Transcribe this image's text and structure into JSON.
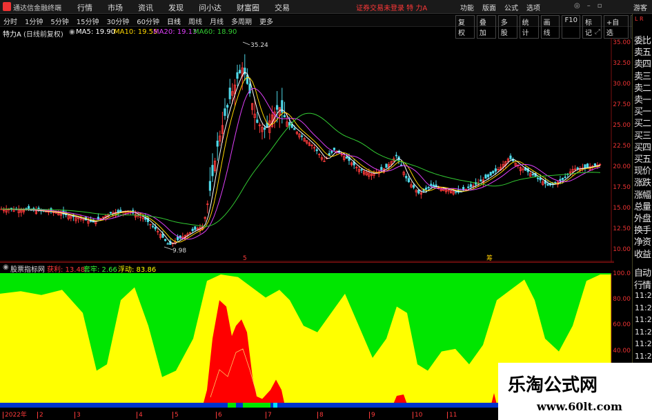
{
  "titlebar": {
    "app_name": "通达信金融终端",
    "menu": [
      "行情",
      "市场",
      "资讯",
      "发现",
      "问小达",
      "财富圈",
      "交易"
    ],
    "alert": "证券交易未登录  特 力A",
    "right_menu": [
      "功能",
      "版面",
      "公式",
      "选项"
    ],
    "guest": "游客"
  },
  "periods": [
    "分时",
    "1分钟",
    "5分钟",
    "15分钟",
    "30分钟",
    "60分钟",
    "日线",
    "周线",
    "月线",
    "多周期",
    "更多"
  ],
  "active_period": "日线",
  "tools": [
    "复权",
    "叠加",
    "多股",
    "统计",
    "画线",
    "F10",
    "标记",
    "+自选",
    "返回"
  ],
  "info": {
    "stock": "特力A",
    "mode": "(日线前复权)",
    "ma5": "MA5: 19.90",
    "ma10": "MA10: 19.55",
    "ma20": "MA20: 19.13",
    "ma60": "MA60: 18.90"
  },
  "indicator": {
    "name": "股票指标网",
    "lbl1": "获利: 13.48",
    "lbl2": "套牢: 2.66",
    "lbl3": "浮动: 83.86"
  },
  "annotations": {
    "high": "35.24",
    "low": "9.98",
    "m1": "5",
    "m2": "筹"
  },
  "y_axis_main": [
    "35.00",
    "32.50",
    "30.00",
    "27.50",
    "25.00",
    "22.50",
    "20.00",
    "17.50",
    "15.00",
    "12.50",
    "10.00"
  ],
  "y_axis_sub": [
    "100.0",
    "80.00",
    "60.00",
    "40.00"
  ],
  "x_axis": [
    "2022年",
    "2",
    "3",
    "4",
    "5",
    "6",
    "7",
    "8",
    "9",
    "10",
    "11"
  ],
  "sidepanel": {
    "corner": "L R",
    "items": [
      "委比",
      "卖五",
      "卖四",
      "卖三",
      "卖二",
      "卖一",
      "买一",
      "买二",
      "买三",
      "买四",
      "买五",
      "现价",
      "涨跌",
      "涨幅",
      "总量",
      "外盘",
      "换手",
      "净资",
      "收益",
      "自动",
      "行情"
    ],
    "times": [
      "11:28",
      "11:28",
      "11:28",
      "11:27",
      "11:27",
      "11:27",
      "11:27",
      "11:27"
    ]
  },
  "watermark": {
    "cn": "乐淘公式网",
    "url": "www.60lt.com"
  },
  "colors": {
    "up": "#ff3b3b",
    "down": "#4fd8e8",
    "ma5": "#ffffff",
    "ma10": "#ffd700",
    "ma20": "#e040fb",
    "ma60": "#33cc33",
    "green": "#00e600",
    "yellow": "#ffff00",
    "red": "#ff0000"
  }
}
